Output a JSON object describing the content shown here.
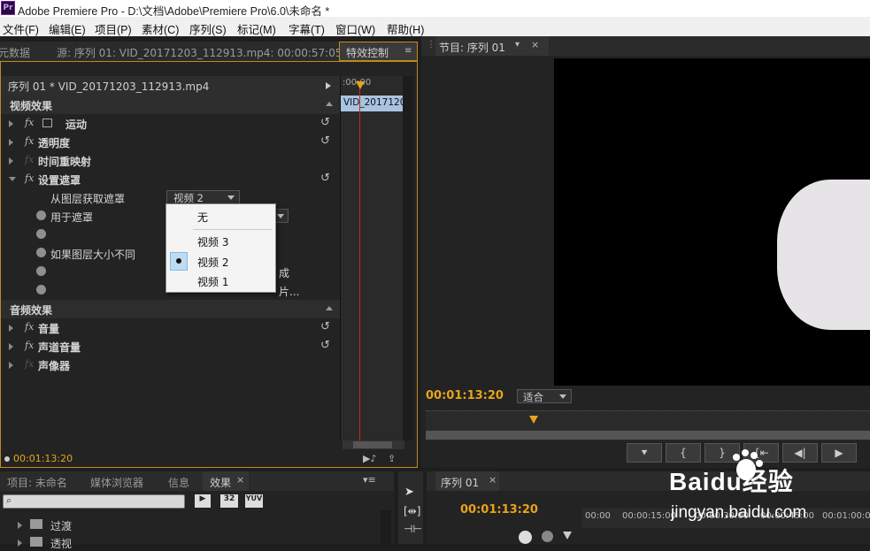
{
  "window": {
    "title": "Adobe Premiere Pro - D:\\文档\\Adobe\\Premiere Pro\\6.0\\未命名 *",
    "logo": "Pr"
  },
  "menu": [
    "文件(F)",
    "编辑(E)",
    "项目(P)",
    "素材(C)",
    "序列(S)",
    "标记(M)",
    "字幕(T)",
    "窗口(W)",
    "帮助(H)"
  ],
  "left_top_tabs": {
    "metadata": "元数据",
    "source": "源: 序列 01: VID_20171203_112913.mp4: 00:00:57:05",
    "effect_controls": "特效控制"
  },
  "fx": {
    "clip_name": "序列 01 * VID_20171203_112913.mp4",
    "video_effects": "视频效果",
    "motion": "运动",
    "opacity": "透明度",
    "time_remap": "时间重映射",
    "track_matte": "设置遮罩",
    "get_matte_from": "从图层获取遮罩",
    "layer_value": "视频 2",
    "use_for_matte": "用于遮罩",
    "if_size_differs": "如果图层大小不同",
    "partial_text1": "成",
    "partial_text2": "片...",
    "audio_effects": "音频效果",
    "volume": "音量",
    "channel_volume": "声道音量",
    "panner": "声像器",
    "timecode": "00:01:13:20",
    "timeline_start": ":00:00",
    "clip_label": "VID_2017120"
  },
  "dropdown": {
    "none": "无",
    "items": [
      "视频 3",
      "视频 2",
      "视频 1"
    ],
    "selected_index": 1
  },
  "program": {
    "tab": "节目: 序列 01",
    "timecode": "00:01:13:20",
    "fit": "适合"
  },
  "bottom_left_tabs": {
    "project": "项目: 未命名",
    "media_browser": "媒体浏览器",
    "info": "信息",
    "effects": "效果"
  },
  "effects_list": [
    "过渡",
    "透视"
  ],
  "effects_badges": [
    "32",
    "YUV"
  ],
  "timeline": {
    "tab": "序列 01",
    "timecode": "00:01:13:20",
    "ticks": [
      "00:00",
      "00:00:15:00",
      "00:00:30:00",
      "00:00:45:00",
      "00:01:00:00"
    ]
  },
  "watermark": {
    "brand": "Baidu经验",
    "url": "jingyan.baidu.com"
  },
  "colors": {
    "accent": "#e8a31a",
    "selection": "#5b9bd5",
    "panel_bg": "#232323"
  }
}
